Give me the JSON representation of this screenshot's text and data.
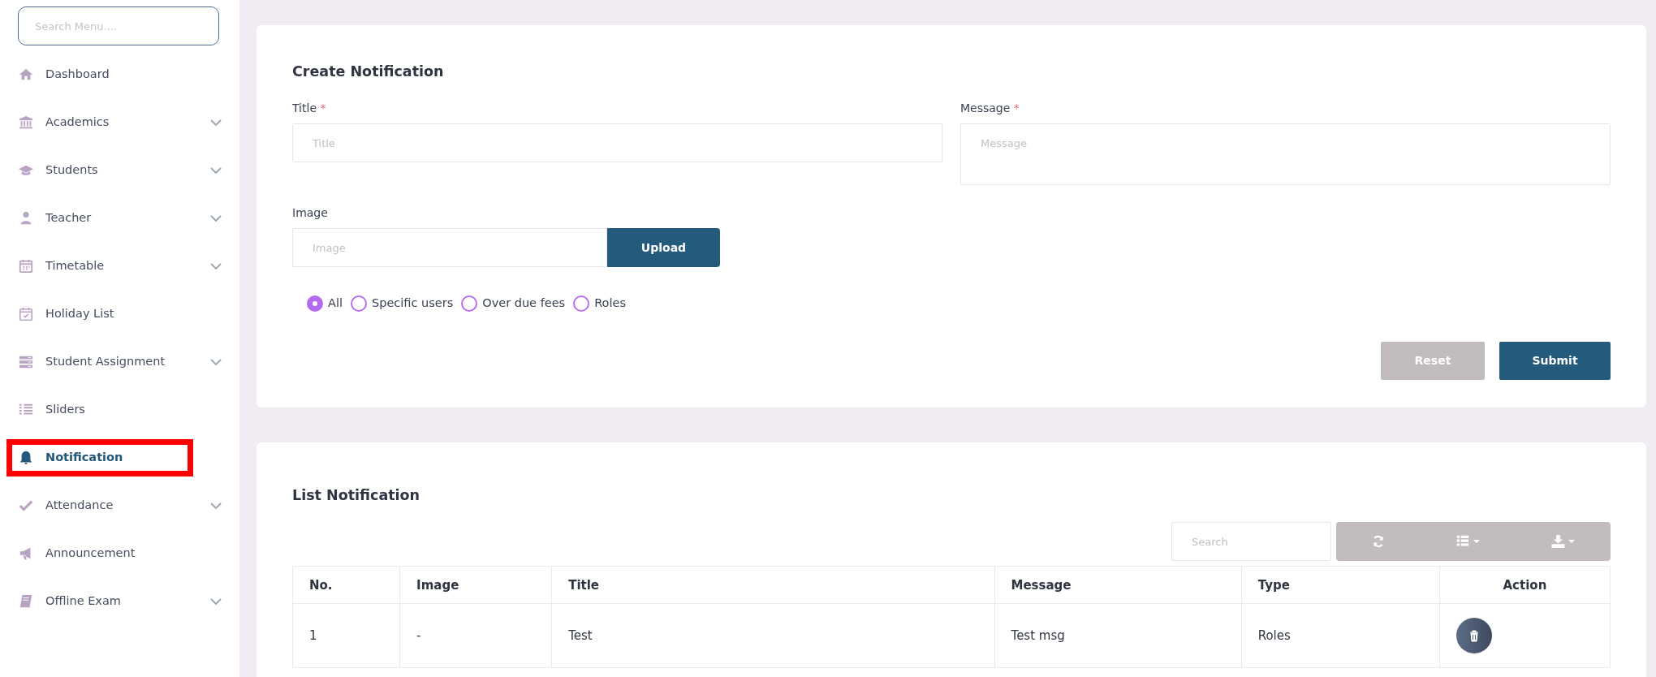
{
  "sidebar": {
    "search": {
      "placeholder": "Search Menu...."
    },
    "items": [
      {
        "label": "Dashboard",
        "has_submenu": false,
        "selected": false,
        "annotated": false
      },
      {
        "label": "Academics",
        "has_submenu": true,
        "selected": false,
        "annotated": false
      },
      {
        "label": "Students",
        "has_submenu": true,
        "selected": false,
        "annotated": false
      },
      {
        "label": "Teacher",
        "has_submenu": true,
        "selected": false,
        "annotated": false
      },
      {
        "label": "Timetable",
        "has_submenu": true,
        "selected": false,
        "annotated": false
      },
      {
        "label": "Holiday List",
        "has_submenu": false,
        "selected": false,
        "annotated": false
      },
      {
        "label": "Student Assignment",
        "has_submenu": true,
        "selected": false,
        "annotated": false
      },
      {
        "label": "Sliders",
        "has_submenu": false,
        "selected": false,
        "annotated": false
      },
      {
        "label": "Notification",
        "has_submenu": false,
        "selected": true,
        "annotated": true
      },
      {
        "label": "Attendance",
        "has_submenu": true,
        "selected": false,
        "annotated": false
      },
      {
        "label": "Announcement",
        "has_submenu": false,
        "selected": false,
        "annotated": false
      },
      {
        "label": "Offline Exam",
        "has_submenu": true,
        "selected": false,
        "annotated": false
      }
    ]
  },
  "create": {
    "title": "Create Notification",
    "title_field": {
      "label": "Title",
      "required_mark": "*",
      "placeholder": "Title"
    },
    "message_field": {
      "label": "Message",
      "required_mark": "*",
      "placeholder": "Message"
    },
    "image_field": {
      "label": "Image",
      "placeholder": "Image",
      "button": "Upload"
    },
    "audience": [
      {
        "label": "All",
        "selected": true
      },
      {
        "label": "Specific users",
        "selected": false
      },
      {
        "label": "Over due fees",
        "selected": false
      },
      {
        "label": "Roles",
        "selected": false
      }
    ],
    "buttons": [
      {
        "label": "Reset",
        "kind": "reset"
      },
      {
        "label": "Submit",
        "kind": "submit"
      }
    ]
  },
  "list": {
    "title": "List Notification",
    "search": {
      "placeholder": "Search"
    },
    "table": {
      "columns": [
        "No.",
        "Image",
        "Title",
        "Message",
        "Type",
        "Action"
      ],
      "rows": [
        [
          "1",
          "-",
          "Test",
          "Test msg",
          "Roles"
        ]
      ]
    }
  }
}
